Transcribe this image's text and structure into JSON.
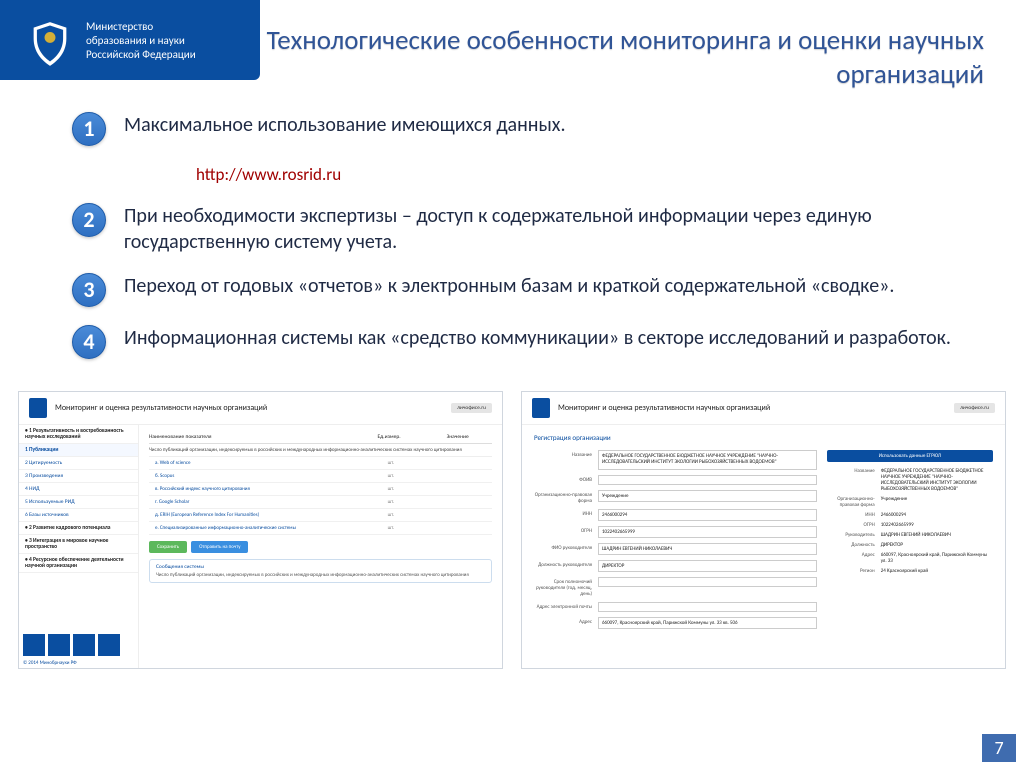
{
  "header": {
    "ministry_l1": "Министерство",
    "ministry_l2": "образования и науки",
    "ministry_l3": "Российской Федерации",
    "title": "Технологические особенности мониторинга и оценки научных организаций"
  },
  "points": [
    {
      "n": "1",
      "text": "Максимальное использование имеющихся данных."
    },
    {
      "n": "2",
      "text": "При необходимости экспертизы – доступ к содержательной информации через единую государственную систему учета."
    },
    {
      "n": "3",
      "text": "Переход от годовых «отчетов» к электронным базам и краткой содержательной «сводке»."
    },
    {
      "n": "4",
      "text": "Информационная системы как «средство коммуникации» в секторе исследований и разработок."
    }
  ],
  "link": "http://www.rosrid.ru",
  "shot_left": {
    "title": "Мониторинг и оценка результативности научных организаций",
    "login": "личофисе.ru",
    "side_head": "• 1 Результативность и востребованность научных исследований",
    "side_items": [
      "1 Публикации",
      "2 Цитируемость",
      "3 Произведения",
      "4 НИД",
      "5 Используемые РИД",
      "6 Базы источников"
    ],
    "side_groups": [
      "• 2 Развитие кадрового потенциала",
      "• 3 Интеграция в мировое научное пространство",
      "• 4 Ресурсное обеспечение деятельности научной организации"
    ],
    "copy": "© 2014 Минобрнауки РФ",
    "thead": [
      "Наименование показателя",
      "Ед.измер.",
      "Значение"
    ],
    "section": "Число публикаций организации, индексируемых в российских и международных информационно-аналитических системах научного цитирования",
    "rows": [
      {
        "a": "а. Web of science",
        "u": "шт."
      },
      {
        "a": "б. Scopus",
        "u": "шт."
      },
      {
        "a": "в. Российский индекс научного цитирования",
        "u": "шт."
      },
      {
        "a": "г. Google Scholar",
        "u": "шт."
      },
      {
        "a": "д. ERIH (European Reference Index For Humanities)",
        "u": "шт."
      },
      {
        "a": "е. Специализированные информационно-аналитические системы",
        "u": "шт."
      }
    ],
    "btn_save": "Сохранить",
    "btn_send": "Отправить на почту",
    "msg_h": "Сообщения системы",
    "msg_b": "Число публикаций организации, индексируемых в российских и международных информационно-аналитических системах научного цитирования"
  },
  "shot_right": {
    "title": "Мониторинг и оценка результативности научных организаций",
    "login": "личофисе.ru",
    "form_title": "Регистрация организации",
    "btn_use": "Использовать данные ЕГРЮЛ",
    "fields": {
      "name_l": "Название",
      "name_v": "ФЕДЕРАЛЬНОЕ ГОСУДАРСТВЕННОЕ БЮДЖЕТНОЕ НАУЧНОЕ УЧРЕЖДЕНИЕ \"НАУЧНО-ИССЛЕДОВАТЕЛЬСКИЙ ИНСТИТУТ ЭКОЛОГИИ РЫБОХОЗЯЙСТВЕННЫХ ВОДОЕМОВ\"",
      "foiv_l": "ФОИВ",
      "foiv_v": "",
      "opf_l": "Организационно-правовая форма",
      "opf_v": "Учреждение",
      "inn_l": "ИНН",
      "inn_v": "2466000294",
      "ogrn_l": "ОГРН",
      "ogrn_v": "1022402665999",
      "fio_l": "ФИО руководителя",
      "fio_v": "ШАДРИН ЕВГЕНИЙ НИКОЛАЕВИЧ",
      "pos_l": "Должность руководителя",
      "pos_v": "ДИРЕКТОР",
      "term_l": "Срок полномочий руководителя (год, месяц, день)",
      "email_l": "Адрес электронной почты",
      "addr_l": "Адрес",
      "addr_v": "660097, Красноярский край, Парижской Коммуны ул. 33 кв. 506"
    },
    "kv": [
      {
        "k": "Название",
        "v": "ФЕДЕРАЛЬНОЕ ГОСУДАРСТВЕННОЕ БЮДЖЕТНОЕ НАУЧНОЕ УЧРЕЖДЕНИЕ \"НАУЧНО-ИССЛЕДОВАТЕЛЬСКИЙ ИНСТИТУТ ЭКОЛОГИИ РЫБОХОЗЯЙСТВЕННЫХ ВОДОЕМОВ\""
      },
      {
        "k": "Организационно-правовая форма",
        "v": "Учреждение"
      },
      {
        "k": "ИНН",
        "v": "2466000294"
      },
      {
        "k": "ОГРН",
        "v": "1022402665999"
      },
      {
        "k": "Руководитель",
        "v": "ШАДРИН ЕВГЕНИЙ НИКОЛАЕВИЧ"
      },
      {
        "k": "Должность",
        "v": "ДИРЕКТОР"
      },
      {
        "k": "Адрес",
        "v": "660097, Красноярский край, Парижской Коммуны ул. 33"
      },
      {
        "k": "Регион",
        "v": "24 Красноярский край"
      }
    ]
  },
  "page_num": "7"
}
